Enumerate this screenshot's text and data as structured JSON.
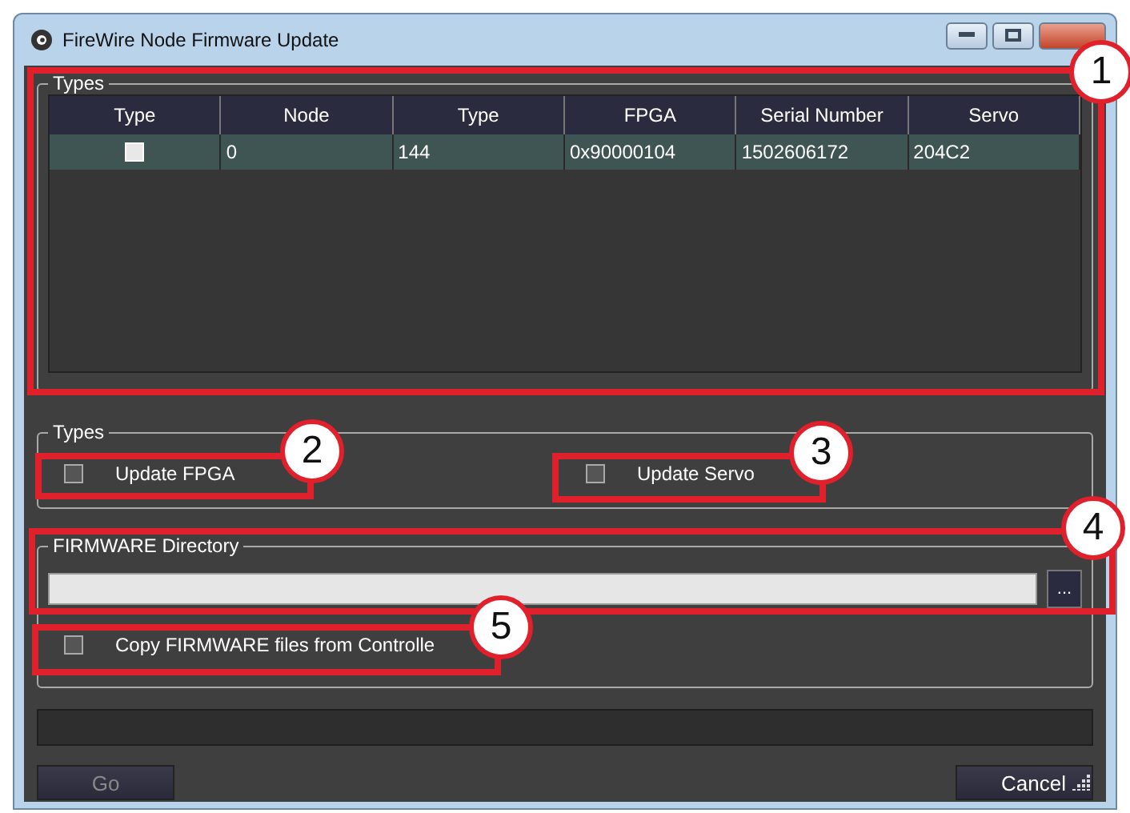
{
  "window": {
    "title": "FireWire Node Firmware Update"
  },
  "nodes_group": {
    "legend": "Types",
    "columns": [
      "Type",
      "Node",
      "Type",
      "FPGA",
      "Serial Number",
      "Servo"
    ],
    "rows": [
      {
        "selected": true,
        "cells": [
          {
            "kind": "checkbox",
            "checked": false
          },
          {
            "kind": "text",
            "text": "0"
          },
          {
            "kind": "text",
            "text": "144"
          },
          {
            "kind": "text",
            "text": "0x90000104"
          },
          {
            "kind": "text",
            "text": "1502606172"
          },
          {
            "kind": "text",
            "text": "204C2"
          }
        ]
      }
    ]
  },
  "types_group": {
    "legend": "Types",
    "options": [
      {
        "label": "Update FPGA",
        "checked": false
      },
      {
        "label": "Update Servo",
        "checked": false
      }
    ]
  },
  "firmware": {
    "legend": "FIRMWARE Directory",
    "browse_button": "..."
  },
  "copy_option": {
    "label": "Copy FIRMWARE files from Controlle",
    "checked": false
  },
  "progress": {
    "level": 0
  },
  "buttons": [
    {
      "label": "Go",
      "disabled": true
    },
    {
      "label": "Cancel",
      "disabled": false
    }
  ],
  "callouts": [
    "1",
    "2",
    "3",
    "4",
    "5"
  ]
}
